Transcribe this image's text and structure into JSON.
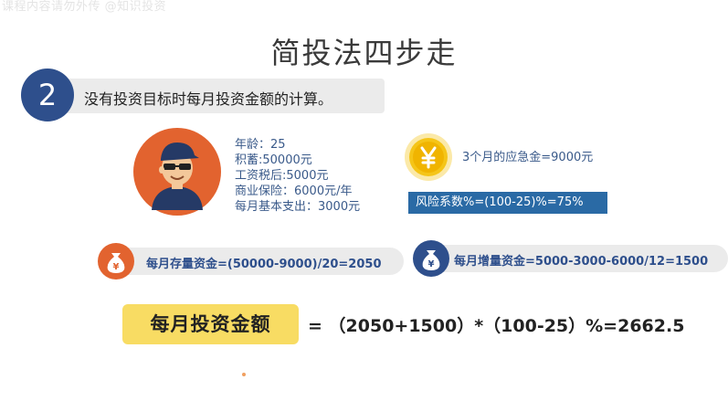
{
  "watermark": "课程内容请勿外传 @知识投资",
  "title": "简投法四步走",
  "step": {
    "number": "2",
    "text": "没有投资目标时每月投资金额的计算。"
  },
  "profile": {
    "age": "年龄：25",
    "savings": "积蓄:50000元",
    "salary": "工资税后:5000元",
    "insurance": "商业保险：6000元/年",
    "expense": "每月基本支出：3000元"
  },
  "emergency": "3个月的应急金=9000元",
  "risk": "风险系数%=(100-25)%=75%",
  "stock_fund": "每月存量资金=(50000-9000)/20=2050",
  "increment_fund": "每月增量资金=5000-3000-6000/12=1500",
  "result_label": "每月投资金额",
  "formula": "= （2050+1500）*（100-25）%=2662.5",
  "icons": {
    "avatar": "person-avatar-icon",
    "coin": "yen-coin-icon",
    "bag": "money-bag-icon"
  },
  "colors": {
    "navy": "#2e4f8c",
    "orange": "#e2632f",
    "gold": "#f5c518",
    "highlight": "#f8dc63",
    "risk_blue": "#2a6aa5"
  }
}
